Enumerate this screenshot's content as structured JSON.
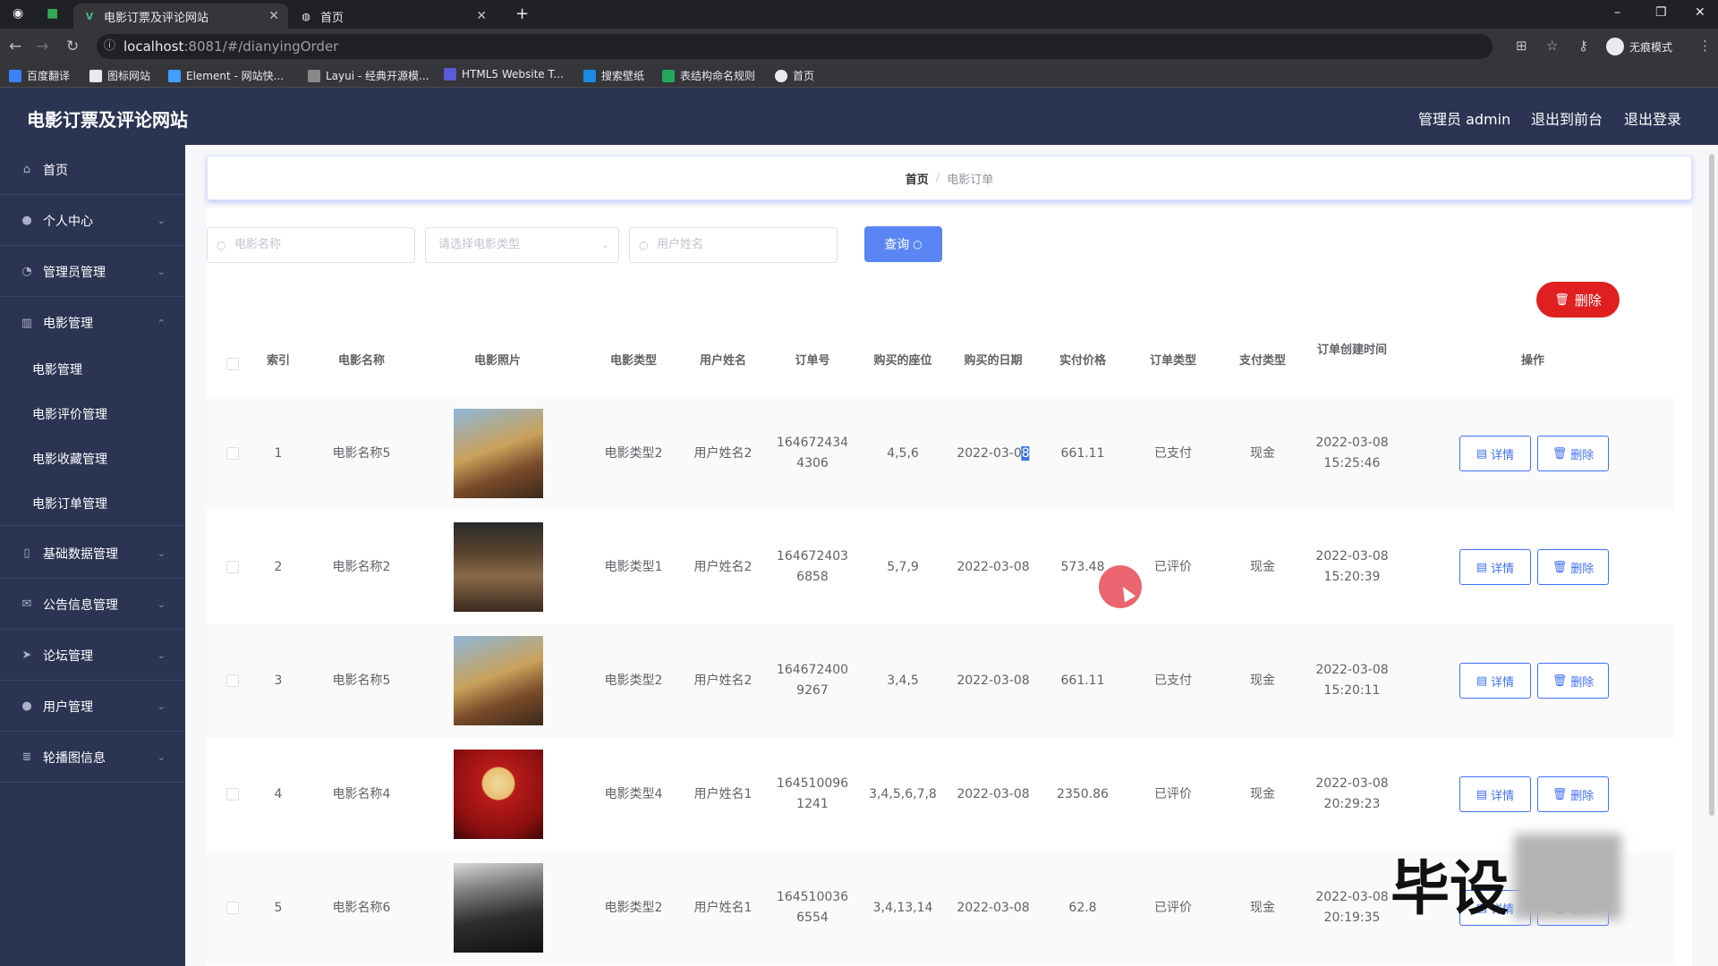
{
  "browser": {
    "tabs": [
      {
        "title": "电影订票及评论网站",
        "active": true
      },
      {
        "title": "首页",
        "active": false
      }
    ],
    "url_host": "localhost",
    "url_path": ":8081/#/dianyingOrder",
    "incognito_label": "无痕模式",
    "bookmarks": [
      "百度翻译",
      "图标网站",
      "Element - 网站快...",
      "Layui - 经典开源模...",
      "HTML5 Website T...",
      "搜索壁纸",
      "表结构命名规则",
      "首页"
    ]
  },
  "header": {
    "title": "电影订票及评论网站",
    "admin": "管理员 admin",
    "to_front": "退出到前台",
    "logout": "退出登录"
  },
  "sidebar": {
    "items": [
      {
        "label": "首页",
        "icon": "home-icon"
      },
      {
        "label": "个人中心",
        "icon": "user-icon"
      },
      {
        "label": "管理员管理",
        "icon": "gauge-icon"
      },
      {
        "label": "电影管理",
        "icon": "chart-icon",
        "expanded": true
      },
      {
        "label": "基础数据管理",
        "icon": "phone-icon"
      },
      {
        "label": "公告信息管理",
        "icon": "ticket-icon"
      },
      {
        "label": "论坛管理",
        "icon": "send-icon"
      },
      {
        "label": "用户管理",
        "icon": "user-icon"
      },
      {
        "label": "轮播图信息",
        "icon": "stack-icon"
      }
    ],
    "sub_items": [
      "电影管理",
      "电影评价管理",
      "电影收藏管理",
      "电影订单管理"
    ]
  },
  "breadcrumb": {
    "home": "首页",
    "current": "电影订单"
  },
  "search": {
    "movie_name_placeholder": "电影名称",
    "movie_type_placeholder": "请选择电影类型",
    "user_name_placeholder": "用户姓名",
    "query_label": "查询"
  },
  "toolbar": {
    "delete_label": "删除"
  },
  "table": {
    "headers": [
      "索引",
      "电影名称",
      "电影照片",
      "电影类型",
      "用户姓名",
      "订单号",
      "购买的座位",
      "购买的日期",
      "实付价格",
      "订单类型",
      "支付类型",
      "订单创建时间",
      "操作"
    ],
    "detail_label": "详情",
    "delete_label": "删除",
    "rows": [
      {
        "index": "1",
        "name": "电影名称5",
        "type": "电影类型2",
        "user": "用户姓名2",
        "order_no_1": "164672434",
        "order_no_2": "4306",
        "seats": "4,5,6",
        "date": "2022-03-0",
        "date_sel": "8",
        "price": "661.11",
        "order_type": "已支付",
        "pay_type": "现金",
        "created_1": "2022-03-08",
        "created_2": "15:25:46"
      },
      {
        "index": "2",
        "name": "电影名称2",
        "type": "电影类型1",
        "user": "用户姓名2",
        "order_no_1": "164672403",
        "order_no_2": "6858",
        "seats": "5,7,9",
        "date": "2022-03-08",
        "date_sel": "",
        "price": "573.48",
        "order_type": "已评价",
        "pay_type": "现金",
        "created_1": "2022-03-08",
        "created_2": "15:20:39"
      },
      {
        "index": "3",
        "name": "电影名称5",
        "type": "电影类型2",
        "user": "用户姓名2",
        "order_no_1": "164672400",
        "order_no_2": "9267",
        "seats": "3,4,5",
        "date": "2022-03-08",
        "date_sel": "",
        "price": "661.11",
        "order_type": "已支付",
        "pay_type": "现金",
        "created_1": "2022-03-08",
        "created_2": "15:20:11"
      },
      {
        "index": "4",
        "name": "电影名称4",
        "type": "电影类型4",
        "user": "用户姓名1",
        "order_no_1": "164510096",
        "order_no_2": "1241",
        "seats": "3,4,5,6,7,8",
        "date": "2022-03-08",
        "date_sel": "",
        "price": "2350.86",
        "order_type": "已评价",
        "pay_type": "现金",
        "created_1": "2022-03-08",
        "created_2": "20:29:23"
      },
      {
        "index": "5",
        "name": "电影名称6",
        "type": "电影类型2",
        "user": "用户姓名1",
        "order_no_1": "164510036",
        "order_no_2": "6554",
        "seats": "3,4,13,14",
        "date": "2022-03-08",
        "date_sel": "",
        "price": "62.8",
        "order_type": "已评价",
        "pay_type": "现金",
        "created_1": "2022-03-08",
        "created_2": "20:19:35"
      }
    ]
  },
  "watermark": "毕设",
  "colors": {
    "header_bg": "#2b3452",
    "primary": "#3f6fff",
    "danger": "#e02020",
    "query": "#5a86f5"
  }
}
